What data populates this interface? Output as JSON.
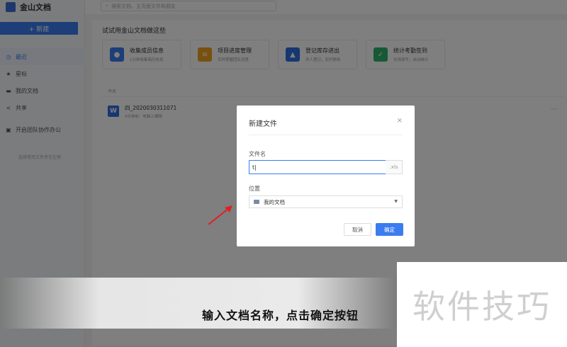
{
  "app": {
    "name": "金山文档"
  },
  "sidebar": {
    "new_button": "+ 新建",
    "items": [
      {
        "label": "最近",
        "icon": "clock-icon"
      },
      {
        "label": "星标",
        "icon": "star-icon"
      },
      {
        "label": "我的文档",
        "icon": "folder-icon"
      },
      {
        "label": "共享",
        "icon": "share-icon"
      }
    ],
    "team_label": "开启团队协作办公",
    "team_hint": "选择常用文件夹至左侧"
  },
  "topbar": {
    "search_placeholder": "搜索文档、主页面文件和朋友"
  },
  "main": {
    "promo_title": "试试用金山文档做这些",
    "cards": [
      {
        "title": "收集成员信息",
        "desc": "1分钟收集简历信息",
        "icon": "people-icon",
        "color": "#3b7cf0"
      },
      {
        "title": "项目进度管理",
        "desc": "实时掌握团队进度",
        "icon": "progress-icon",
        "color": "#f0a020"
      },
      {
        "title": "登记库存进出",
        "desc": "多人登记，实时更新",
        "icon": "warehouse-icon",
        "color": "#2f6ee0"
      },
      {
        "title": "统计考勤签到",
        "desc": "在线填写，自动统计",
        "icon": "checkin-icon",
        "color": "#2fb36b"
      }
    ],
    "section_label": "今天",
    "file": {
      "name": "四_2020030311071",
      "meta": "4分钟前 · 电脑上编辑",
      "more": "···"
    }
  },
  "dialog": {
    "title": "新建文件",
    "close": "×",
    "name_label": "文件名",
    "name_value": "t|",
    "extension": ".xls",
    "location_label": "位置",
    "location_value": "我的文档",
    "cancel_label": "取消",
    "ok_label": "确定"
  },
  "caption": "输入文档名称，点击确定按钮",
  "watermark": "软件技巧",
  "colors": {
    "accent": "#3b7cf0",
    "arrow": "#e02020"
  }
}
